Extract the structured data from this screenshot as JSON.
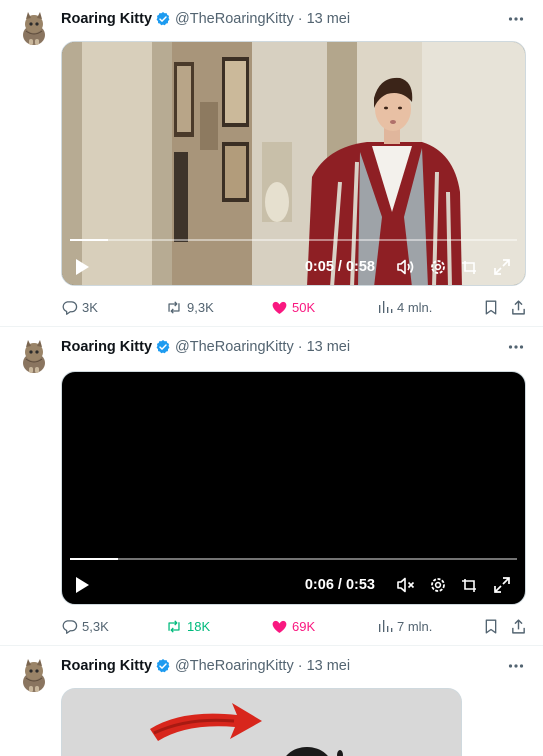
{
  "tweets": [
    {
      "author_name": "Roaring Kitty",
      "handle": "@TheRoaringKitty",
      "separator": "·",
      "date": "13 mei",
      "video": {
        "time": "0:05 / 0:58",
        "progress": 0.086,
        "muted": false
      },
      "counts": {
        "replies": "3K",
        "retweets": "9,3K",
        "likes": "50K",
        "views": "4 mln."
      },
      "liked": true,
      "retweeted": false
    },
    {
      "author_name": "Roaring Kitty",
      "handle": "@TheRoaringKitty",
      "separator": "·",
      "date": "13 mei",
      "video": {
        "time": "0:06 / 0:53",
        "progress": 0.108,
        "muted": true
      },
      "counts": {
        "replies": "5,3K",
        "retweets": "18K",
        "likes": "69K",
        "views": "7 mln."
      },
      "liked": true,
      "retweeted": true
    },
    {
      "author_name": "Roaring Kitty",
      "handle": "@TheRoaringKitty",
      "separator": "·",
      "date": "13 mei"
    }
  ],
  "icons": {
    "verified": "verified-badge-icon",
    "more": "more-dots-icon",
    "reply": "reply-icon",
    "retweet": "retweet-icon",
    "like": "heart-icon",
    "views": "views-chart-icon",
    "bookmark": "bookmark-icon",
    "share": "share-icon",
    "play": "play-icon",
    "volume": "volume-icon",
    "settings": "settings-gear-icon",
    "pip": "picture-in-picture-icon",
    "fullscreen": "fullscreen-icon"
  },
  "colors": {
    "text": "#0f1419",
    "secondary": "#536471",
    "verified": "#1d9bf0",
    "like": "#f91880",
    "retweet": "#00ba7c",
    "divider": "#eff3f4"
  }
}
